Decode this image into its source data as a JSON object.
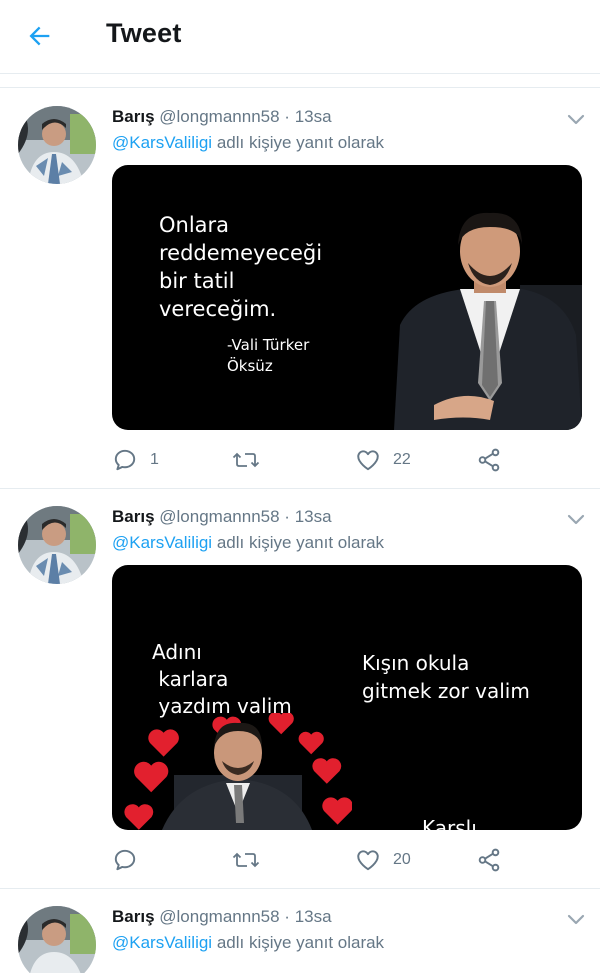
{
  "header": {
    "title": "Tweet",
    "back_icon": "arrow-left-icon",
    "accent": "#1da1f2"
  },
  "tweets": [
    {
      "name": "Barış",
      "handle": "@longmannn58",
      "dot": "·",
      "time": "13sa",
      "reply_mention": "@KarsValiligi",
      "reply_suffix": " adlı kişiye yanıt olarak",
      "media": {
        "quote": "Onlara\nreddemeyeceği\nbir tatil\nvereceğim.",
        "attribution": "-Vali Türker\nÖksüz"
      },
      "actions": {
        "replies": "1",
        "retweets": "",
        "likes": "22"
      }
    },
    {
      "name": "Barış",
      "handle": "@longmannn58",
      "dot": "·",
      "time": "13sa",
      "reply_mention": "@KarsValiligi",
      "reply_suffix": " adlı kişiye yanıt olarak",
      "media": {
        "left_text": "Adını\n karlara\n yazdım valim",
        "right_text": "Kışın okula\ngitmek zor valim",
        "bottom_text": "Karslı"
      },
      "actions": {
        "replies": "",
        "retweets": "",
        "likes": "20"
      }
    },
    {
      "name": "Barış",
      "handle": "@longmannn58",
      "dot": "·",
      "time": "13sa",
      "reply_mention": "@KarsValiligi",
      "reply_suffix": " adlı kişiye yanıt olarak"
    }
  ],
  "colors": {
    "text_primary": "#14171a",
    "text_secondary": "#657786",
    "link": "#1da1f2",
    "divider": "#e6ecf0",
    "heart": "#e0245e"
  }
}
